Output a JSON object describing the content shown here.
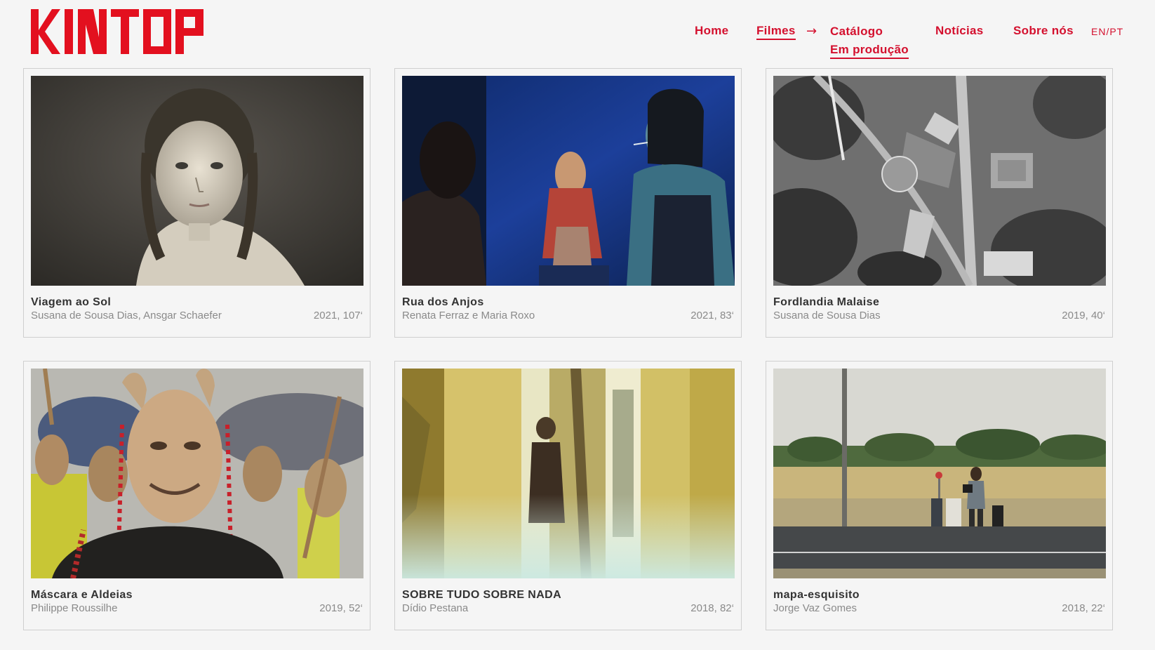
{
  "brand": {
    "name": "KINTOP",
    "color": "#e3101f"
  },
  "nav": {
    "home": "Home",
    "films": "Filmes",
    "arrow": "→",
    "catalog": "Catálogo",
    "in_production": "Em produção",
    "news": "Notícias",
    "about": "Sobre nós",
    "lang": "EN/PT",
    "accent": "#d4102e"
  },
  "films": [
    {
      "title": "Viagem ao Sol",
      "director": "Susana de Sousa Dias, Ansgar Schaefer",
      "meta": "2021, 107‘",
      "image": "girl-portrait-sepia"
    },
    {
      "title": "Rua dos Anjos",
      "director": "Renata Ferraz e Maria Roxo",
      "meta": "2021, 83‘",
      "image": "women-blue-light"
    },
    {
      "title": "Fordlandia Malaise",
      "director": "Susana de Sousa Dias",
      "meta": "2019, 40‘",
      "image": "aerial-bw"
    },
    {
      "title": "Máscara e Aldeias",
      "director": "Philippe Roussilhe",
      "meta": "2019, 52‘",
      "image": "carnival-masks"
    },
    {
      "title": "SOBRE TUDO SOBRE NADA",
      "director": "Dídio Pestana",
      "meta": "2018, 82‘",
      "image": "mirror-yellow"
    },
    {
      "title": "mapa-esquisito",
      "director": "Jorge Vaz Gomes",
      "meta": "2018, 22‘",
      "image": "roadside-suitcases"
    }
  ]
}
